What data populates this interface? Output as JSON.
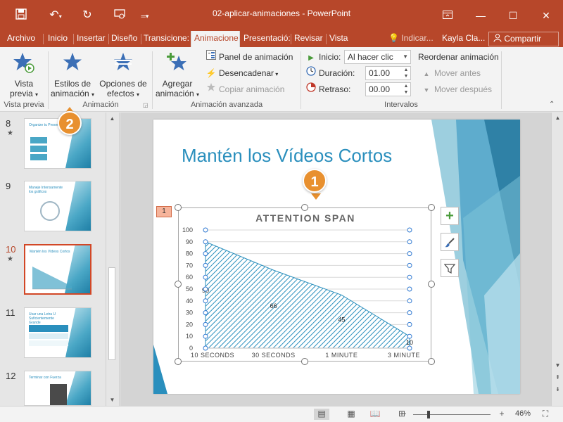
{
  "window": {
    "title": "02-aplicar-animaciones  -  PowerPoint"
  },
  "tabs": [
    {
      "label": "Archivo"
    },
    {
      "label": "Inicio"
    },
    {
      "label": "Insertar"
    },
    {
      "label": "Diseño"
    },
    {
      "label": "Transicione:"
    },
    {
      "label": "Animacione"
    },
    {
      "label": "Presentació:"
    },
    {
      "label": "Revisar"
    },
    {
      "label": "Vista"
    }
  ],
  "tell_me": "Indicar...",
  "user": "Kayla Cla...",
  "share": "Compartir",
  "ribbon": {
    "preview": {
      "label_line1": "Vista",
      "label_line2": "previa",
      "group": "Vista previa"
    },
    "styles": {
      "label_line1": "Estilos de",
      "label_line2": "animación"
    },
    "effect_options": {
      "label_line1": "Opciones de",
      "label_line2": "efectos"
    },
    "animation_group": "Animación",
    "add_animation": {
      "label_line1": "Agregar",
      "label_line2": "animación"
    },
    "animation_pane": "Panel de animación",
    "trigger": "Desencadenar",
    "copy_animation": "Copiar animación",
    "advanced_group": "Animación avanzada",
    "start_label": "Inicio:",
    "start_value": "Al hacer clic",
    "duration_label": "Duración:",
    "duration_value": "01.00",
    "delay_label": "Retraso:",
    "delay_value": "00.00",
    "reorder_label": "Reordenar animación",
    "move_earlier": "Mover antes",
    "move_later": "Mover después",
    "timing_group": "Intervalos"
  },
  "callouts": {
    "one": "1",
    "two": "2"
  },
  "thumbnails": [
    {
      "num": "8",
      "star": "★",
      "title": "Organize tu Presentación"
    },
    {
      "num": "9",
      "star": "",
      "title": "Maneje Intensamente los gráficos"
    },
    {
      "num": "10",
      "star": "★",
      "title": "Mantén los Vídeos Cortos"
    },
    {
      "num": "11",
      "star": "",
      "title": "Usar una Letra U Suficientemente Grande"
    },
    {
      "num": "12",
      "star": "",
      "title": "Terminar con Fuerza"
    }
  ],
  "slide": {
    "title": "Mantén los Vídeos Cortos",
    "anim_tag": "1"
  },
  "chart_data": {
    "type": "area",
    "title": "ATTENTION SPAN",
    "categories": [
      "10 SECONDS",
      "30 SECONDS",
      "1 MINUTE",
      "3 MINUTE"
    ],
    "values": [
      90,
      66,
      45,
      10
    ],
    "data_labels": [
      "90",
      "66",
      "45",
      "10"
    ],
    "ylim": [
      0,
      100
    ],
    "yticks": [
      0,
      10,
      20,
      30,
      40,
      50,
      60,
      70,
      80,
      90,
      100
    ],
    "grid": true,
    "fill": "diagonal-hatch",
    "color": "#2a8fbd"
  },
  "status": {
    "zoom": "46%",
    "zoom_fraction": 0.46
  },
  "colors": {
    "brand": "#b7472a",
    "accent": "#2a8fbd",
    "callout": "#e8902f"
  }
}
